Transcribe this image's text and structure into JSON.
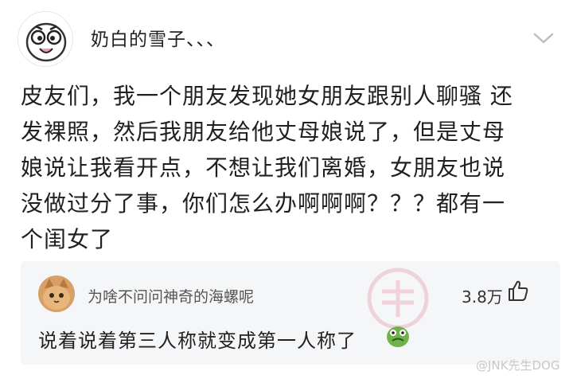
{
  "post": {
    "author_name": "奶白的雪子、、、",
    "avatar_icon": "doodle-face-avatar",
    "menu_icon": "chevron-down-icon",
    "body_lines": [
      "皮友们，我一个朋友发现她女朋友跟别人聊骚 还",
      "发裸照，然后我朋友给他丈母娘说了，但是丈母",
      "娘说让我看开点，不想让我们离婚，女朋友也说",
      "没做过分了事，你们怎么办啊啊啊？？？都有一",
      "个闺女了"
    ]
  },
  "top_comment": {
    "commenter_name": "为啥不问问神奇的海螺呢",
    "avatar_icon": "cat-avatar",
    "like_count": "3.8万",
    "like_icon": "thumbs-up-icon",
    "text": "说着说着第三人称就变成第一人称了",
    "emoji_icon": "green-face-emoji"
  },
  "watermark": "@JNK先生DOG",
  "colors": {
    "background": "#ffffff",
    "card": "#f5f6f8",
    "text": "#202020",
    "muted": "#555555"
  }
}
